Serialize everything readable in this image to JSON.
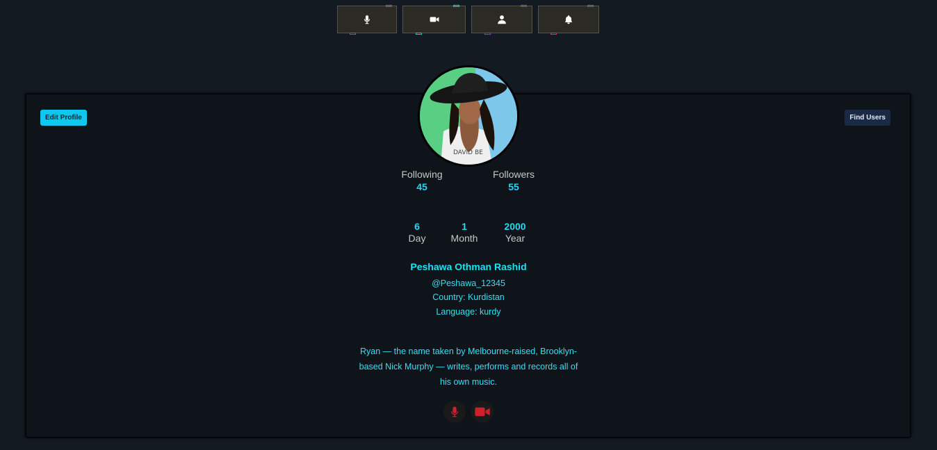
{
  "toolbar": {
    "buttons": [
      {
        "icon": "microphone-icon",
        "marker_color": "#e0297a"
      },
      {
        "icon": "video-camera-icon",
        "marker_color": "#1dc4d8"
      },
      {
        "icon": "user-icon",
        "marker_color": "#8a3cc9"
      },
      {
        "icon": "bell-icon",
        "marker_color": "#e0297a"
      }
    ]
  },
  "profile": {
    "edit_label": "Edit Profile",
    "find_label": "Find Users",
    "following_label": "Following",
    "following_count": "45",
    "followers_label": "Followers",
    "followers_count": "55",
    "birth": {
      "day_value": "6",
      "day_label": "Day",
      "month_value": "1",
      "month_label": "Month",
      "year_value": "2000",
      "year_label": "Year"
    },
    "name": "Peshawa Othman Rashid",
    "username": "@Peshawa_12345",
    "country": "Country: Kurdistan",
    "language": "Language: kurdy",
    "bio": "Ryan — the name taken by Melbourne-raised, Brooklyn-based Nick Murphy — writes, performs and records all of his own music.",
    "avatar_text": "DAVID BE"
  },
  "colors": {
    "accent": "#19e4f5",
    "edit_button": "#10c8ee",
    "find_button": "#1b2a44",
    "media_icon": "#c9222b",
    "background": "#141a22"
  }
}
